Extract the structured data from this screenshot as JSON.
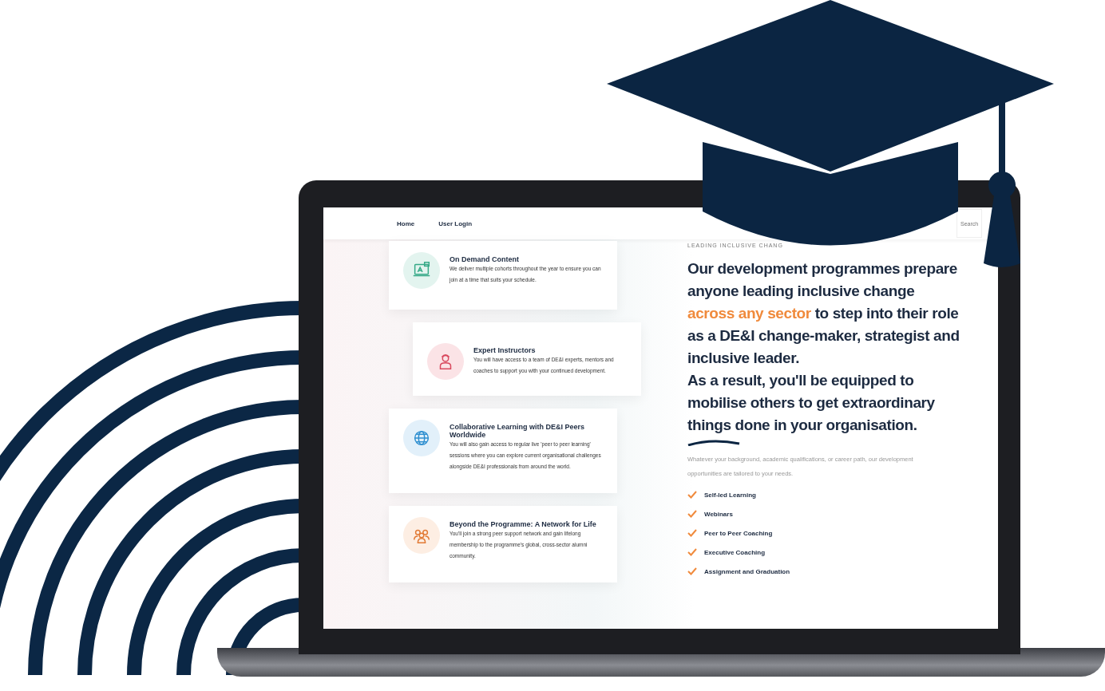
{
  "nav": {
    "links": [
      {
        "label": "Home"
      },
      {
        "label": "User Login"
      }
    ],
    "search": {
      "placeholder": "Search"
    }
  },
  "features": [
    {
      "kind": "laptop",
      "color": "#e3f4ef",
      "title": "On Demand Content",
      "text": "We deliver multiple cohorts throughout the year to ensure you can join at a time that suits your schedule.",
      "offset": false
    },
    {
      "kind": "person",
      "color": "#fbe3e6",
      "title": "Expert Instructors",
      "text": "You will have access to a team of DE&I experts, mentors and coaches to support you with your continued development.",
      "offset": true
    },
    {
      "kind": "globe",
      "color": "#e2f0fa",
      "title": "Collaborative Learning with DE&I Peers Worldwide",
      "text": "You will also gain access to regular live 'peer to peer learning' sessions where you can explore current organisational challenges alongside DE&I professionals from around the world.",
      "offset": false
    },
    {
      "kind": "group",
      "color": "#fdeee3",
      "title": "Beyond the Programme: A Network for Life",
      "text": "You'll join a strong peer support network and gain lifelong membership to the programme's global, cross-sector alumni community.",
      "offset": false
    }
  ],
  "eyebrow": "LEADING INCLUSIVE CHANG",
  "headline": [
    {
      "text": "Our development programmes prepare anyone leading inclusive change ",
      "highlight": false
    },
    {
      "text": "across any sector",
      "highlight": true
    },
    {
      "text": " to step into their role as a DE&I change-maker, strategist and inclusive leader.",
      "highlight": false
    }
  ],
  "headline_continued": "As a result, you'll be equipped to mobilise others to get extraordinary things done in your organisation.",
  "intro": "Whatever your background, academic qualifications, or career path, our development opportunities are tailored to your needs.",
  "checklist": [
    "Self-led Learning",
    "Webinars",
    "Peer to Peer Coaching",
    "Executive Coaching",
    "Assignment and Graduation"
  ]
}
